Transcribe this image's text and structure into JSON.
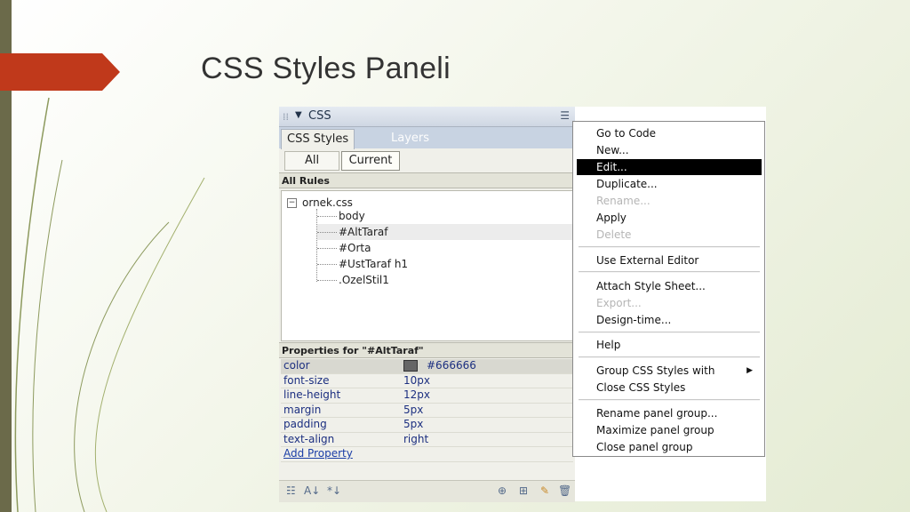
{
  "slide": {
    "title": "CSS Styles Paneli"
  },
  "panel": {
    "title": "CSS",
    "tabs": [
      "CSS Styles",
      "Layers"
    ],
    "buttons": {
      "all": "All",
      "current": "Current"
    },
    "rules_header": "All Rules",
    "tree": {
      "root": "ornek.css",
      "items": [
        "body",
        "#AltTaraf",
        "#Orta",
        "#UstTaraf h1",
        ".OzelStil1"
      ]
    },
    "props_header": "Properties for \"#AltTaraf\"",
    "properties": [
      {
        "name": "color",
        "value": "#666666"
      },
      {
        "name": "font-size",
        "value": "10px"
      },
      {
        "name": "line-height",
        "value": "12px"
      },
      {
        "name": "margin",
        "value": "5px"
      },
      {
        "name": "padding",
        "value": "5px"
      },
      {
        "name": "text-align",
        "value": "right"
      }
    ],
    "add_property": "Add Property"
  },
  "menu": {
    "items": [
      "Go to Code",
      "New...",
      "Edit...",
      "Duplicate...",
      "Rename...",
      "Apply",
      "Delete",
      "Use External Editor",
      "Attach Style Sheet...",
      "Export...",
      "Design-time...",
      "Help",
      "Group CSS Styles with",
      "Close CSS Styles",
      "Rename panel group...",
      "Maximize panel group",
      "Close panel group"
    ]
  },
  "colors": {
    "accent": "#c0391b",
    "left_bar": "#6b6a4a",
    "highlight": "#000000",
    "swatch": "#666666"
  }
}
